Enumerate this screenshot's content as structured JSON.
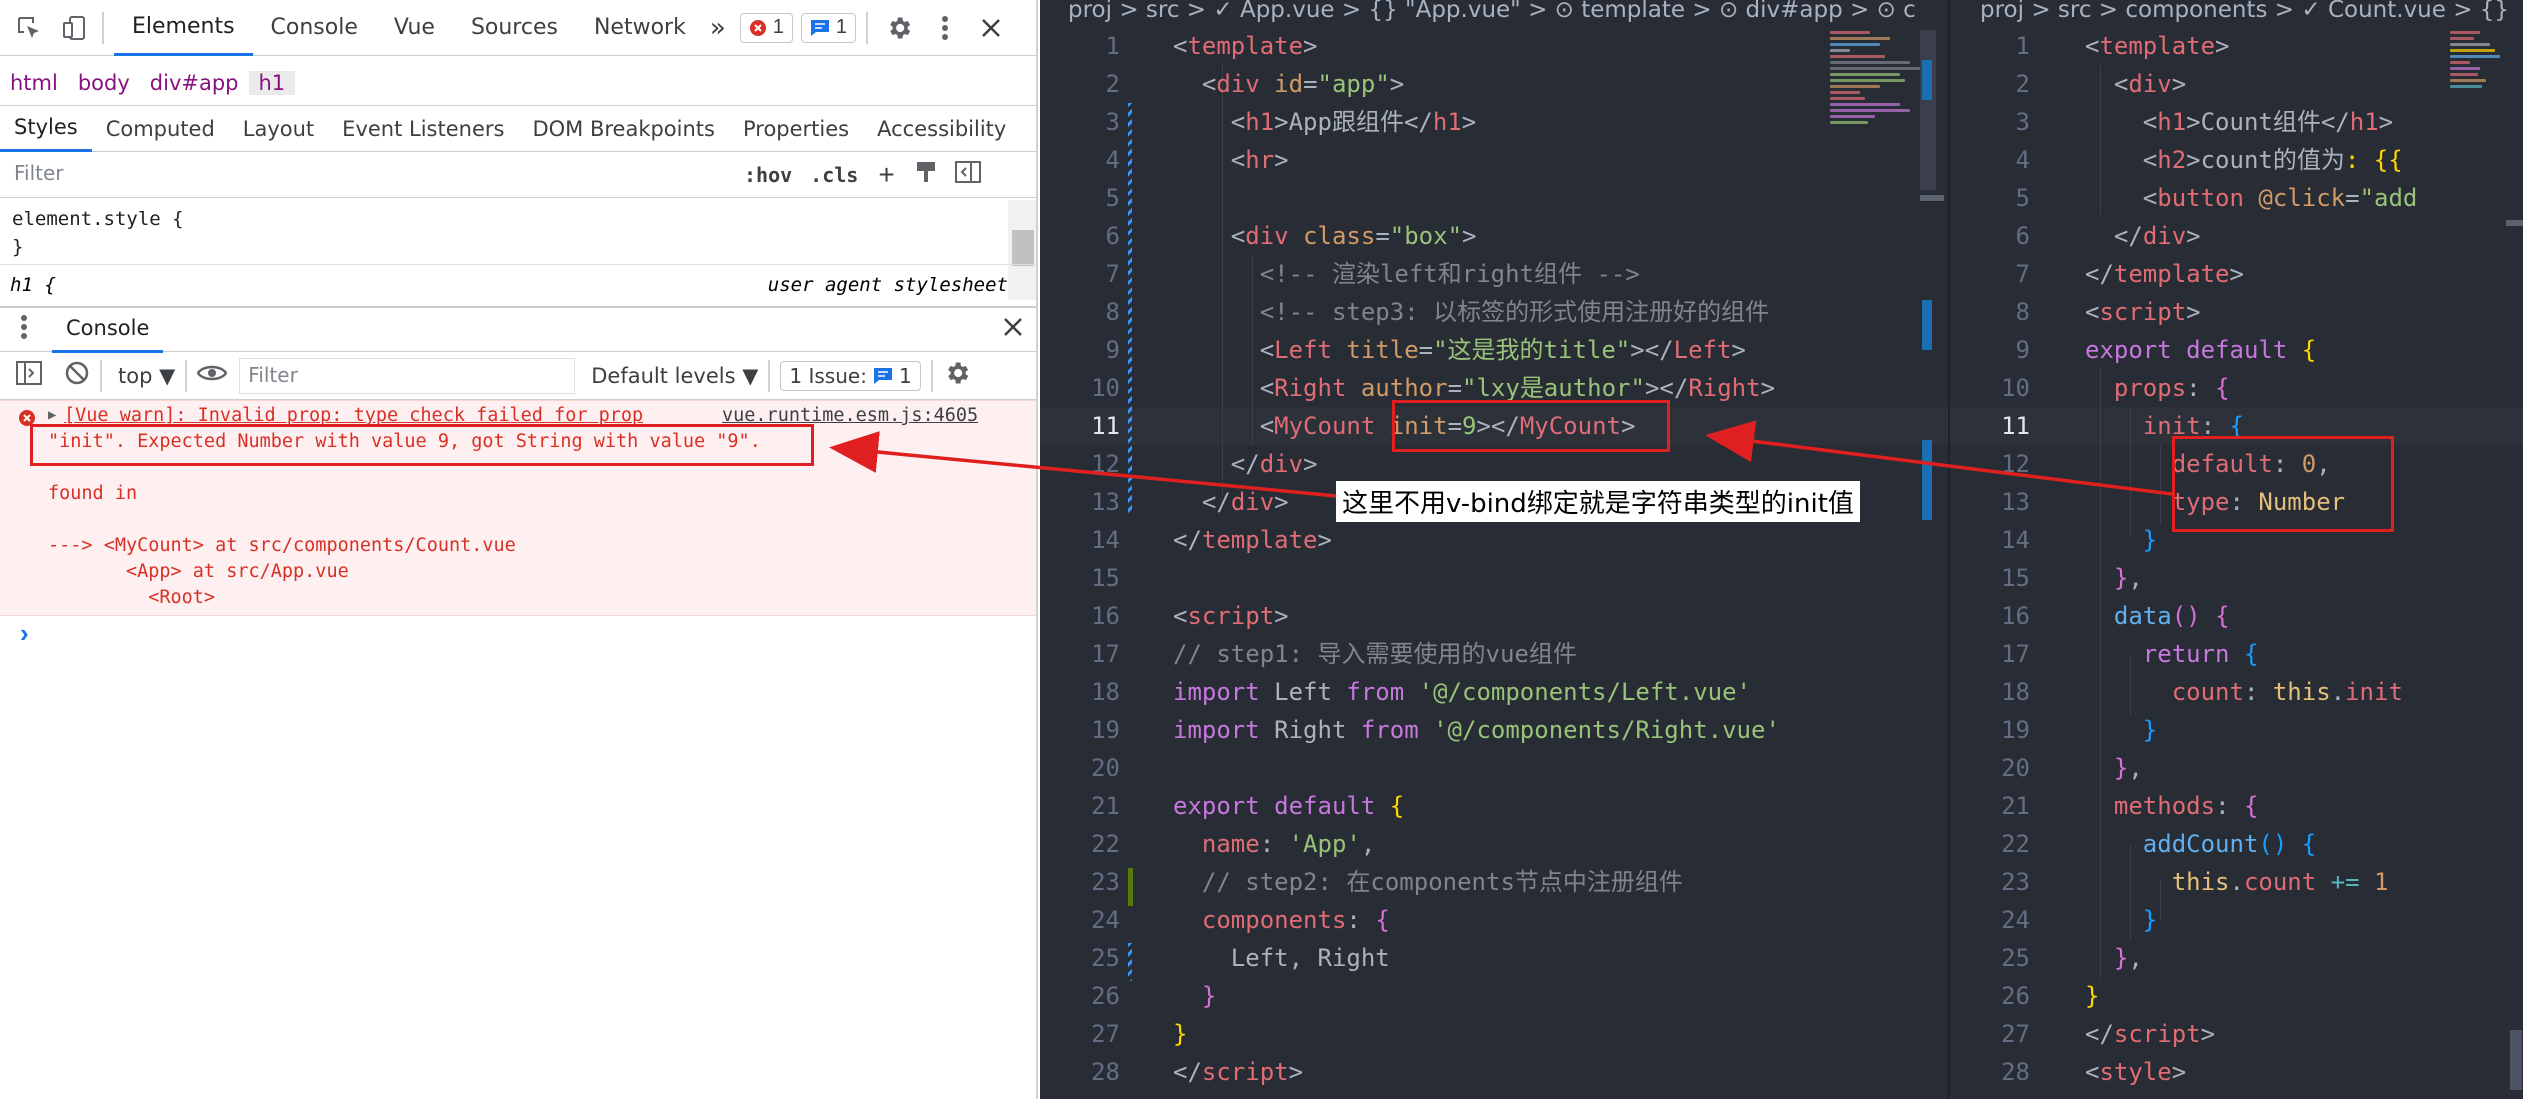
{
  "devtools": {
    "main_tabs": [
      "Elements",
      "Console",
      "Vue",
      "Sources",
      "Network"
    ],
    "overflow": "»",
    "error_badge": "1",
    "message_badge": "1",
    "breadcrumb": [
      "html",
      "body",
      "div#app",
      "h1"
    ],
    "sub_tabs": [
      "Styles",
      "Computed",
      "Layout",
      "Event Listeners",
      "DOM Breakpoints",
      "Properties",
      "Accessibility"
    ],
    "filter_placeholder": "Filter",
    "hov": ":hov",
    "cls": ".cls",
    "element_style_open": "element.style {",
    "element_style_close": "}",
    "h1_selector": "h1 {",
    "ua_label": "user agent stylesheet",
    "drawer_tab": "Console",
    "console_context": "top",
    "console_filter_placeholder": "Filter",
    "default_levels": "Default levels",
    "issue_label": "1 Issue:",
    "issue_count": "1",
    "error": {
      "line1": "[Vue warn]: Invalid prop: type check failed for prop",
      "source": "vue.runtime.esm.js:4605",
      "line2": "\"init\". Expected Number with value 9, got String with value \"9\".",
      "line3": "found in",
      "line4": "---> <MyCount> at src/components/Count.vue",
      "line5": "       <App> at src/App.vue",
      "line6": "         <Root>"
    },
    "prompt": "›"
  },
  "editor_app": {
    "breadcrumb": "proj > src > ✓ App.vue > {} \"App.vue\" > ⊙ template > ⊙ div#app > ⊙ c",
    "current_line": 11
  },
  "editor_count": {
    "breadcrumb": "proj > src > components > ✓ Count.vue > {}",
    "current_line": 11
  },
  "annotation": "这里不用v-bind绑定就是字符串类型的init值",
  "colors": {
    "editor_bg": "#282c34",
    "annotation_red": "#e02020",
    "error_red": "#d93025"
  }
}
